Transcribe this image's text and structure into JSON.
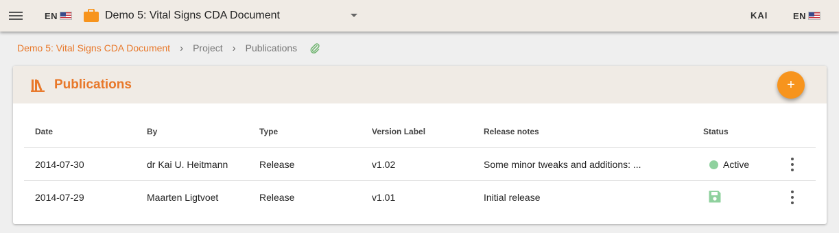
{
  "header": {
    "language_code": "EN",
    "project_name": "Demo 5: Vital Signs CDA Document",
    "user": "KAI",
    "user_language_code": "EN"
  },
  "breadcrumb": [
    "Demo 5: Vital Signs CDA Document",
    "Project",
    "Publications"
  ],
  "card": {
    "title": "Publications",
    "add_label": "+"
  },
  "table": {
    "columns": [
      "Date",
      "By",
      "Type",
      "Version Label",
      "Release notes",
      "Status"
    ],
    "rows": [
      {
        "date": "2014-07-30",
        "by": "dr Kai U. Heitmann",
        "type": "Release",
        "version": "v1.02",
        "notes": "Some minor tweaks and additions: ...",
        "status": "Active"
      },
      {
        "date": "2014-07-29",
        "by": "Maarten Ligtvoet",
        "type": "Release",
        "version": "v1.01",
        "notes": "Initial release",
        "status": ""
      }
    ]
  },
  "colors": {
    "accent": "#e8782a",
    "fab": "#f7941d",
    "header_bg": "#f0ebe5",
    "status_active": "#8fd19e"
  },
  "icons": [
    "menu-icon",
    "us-flag-icon",
    "briefcase-icon",
    "chevron-right-icon",
    "paperclip-icon",
    "books-icon",
    "add-icon",
    "status-active-dot-icon",
    "save-icon",
    "more-vert-icon"
  ]
}
